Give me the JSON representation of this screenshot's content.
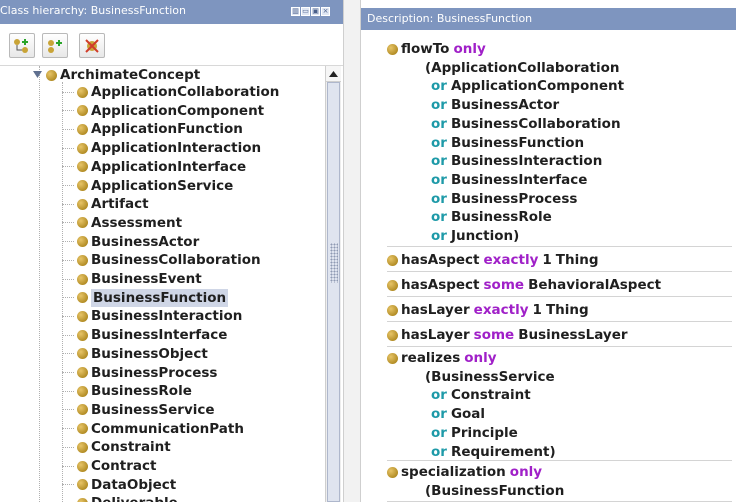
{
  "left_panel": {
    "title": "Class hierarchy: BusinessFunction",
    "toolbar": {
      "buttons": [
        {
          "icon": "add-subclass-icon"
        },
        {
          "icon": "add-sibling-class-icon"
        },
        {
          "icon": "delete-class-icon"
        }
      ]
    },
    "tree": {
      "root": "ArchimateConcept",
      "selected": "BusinessFunction",
      "items": [
        "ApplicationCollaboration",
        "ApplicationComponent",
        "ApplicationFunction",
        "ApplicationInteraction",
        "ApplicationInterface",
        "ApplicationService",
        "Artifact",
        "Assessment",
        "BusinessActor",
        "BusinessCollaboration",
        "BusinessEvent",
        "BusinessFunction",
        "BusinessInteraction",
        "BusinessInterface",
        "BusinessObject",
        "BusinessProcess",
        "BusinessRole",
        "BusinessService",
        "CommunicationPath",
        "Constraint",
        "Contract",
        "DataObject",
        "Deliverable"
      ]
    }
  },
  "right_panel": {
    "title": "Description: BusinessFunction",
    "blocks": [
      {
        "property": "flowTo",
        "keyword": "only",
        "open": "(ApplicationCollaboration",
        "alternatives": [
          "ApplicationComponent",
          "BusinessActor",
          "BusinessCollaboration",
          "BusinessFunction",
          "BusinessInteraction",
          "BusinessInterface",
          "BusinessProcess",
          "BusinessRole"
        ],
        "last": "Junction)",
        "or_word": "or"
      },
      {
        "property": "hasAspect",
        "keyword": "exactly",
        "number": "1",
        "filler": "Thing"
      },
      {
        "property": "hasAspect",
        "keyword": "some",
        "filler": "BehavioralAspect"
      },
      {
        "property": "hasLayer",
        "keyword": "exactly",
        "number": "1",
        "filler": "Thing"
      },
      {
        "property": "hasLayer",
        "keyword": "some",
        "filler": "BusinessLayer"
      },
      {
        "property": "realizes",
        "keyword": "only",
        "open": "(BusinessService",
        "alternatives": [
          "Constraint",
          "Goal",
          "Principle"
        ],
        "last": "Requirement)",
        "or_word": "or"
      },
      {
        "property": "specialization",
        "keyword": "only",
        "open": "(BusinessFunction"
      }
    ]
  },
  "colors": {
    "header_bg": "#7e95bf",
    "keyword": "#a020c8",
    "or_keyword": "#1e9aa8",
    "entity_dot": "#c9a437",
    "selection_bg": "#cfd6e6"
  }
}
